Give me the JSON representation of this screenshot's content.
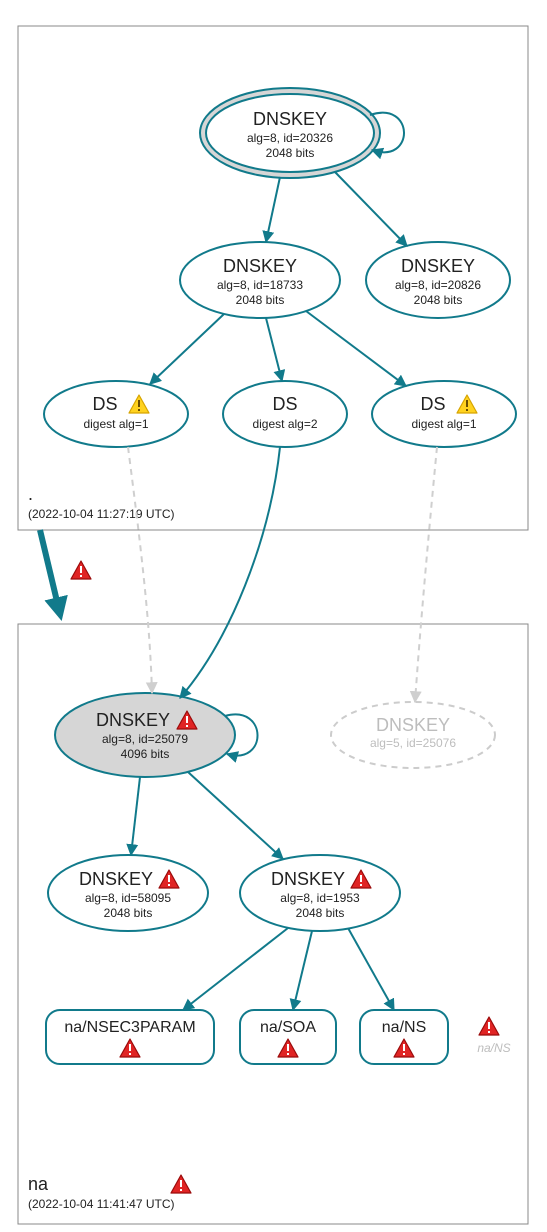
{
  "zone_root": {
    "label": ".",
    "timestamp": "(2022-10-04 11:27:19 UTC)"
  },
  "zone_na": {
    "label": "na",
    "timestamp": "(2022-10-04 11:41:47 UTC)"
  },
  "root_ksk": {
    "title": "DNSKEY",
    "line2": "alg=8, id=20326",
    "line3": "2048 bits"
  },
  "root_zsk": {
    "title": "DNSKEY",
    "line2": "alg=8, id=18733",
    "line3": "2048 bits"
  },
  "root_key3": {
    "title": "DNSKEY",
    "line2": "alg=8, id=20826",
    "line3": "2048 bits"
  },
  "ds1": {
    "title": "DS",
    "line2": "digest alg=1"
  },
  "ds2": {
    "title": "DS",
    "line2": "digest alg=2"
  },
  "ds3": {
    "title": "DS",
    "line2": "digest alg=1"
  },
  "na_ksk": {
    "title": "DNSKEY",
    "line2": "alg=8, id=25079",
    "line3": "4096 bits"
  },
  "na_key_faded": {
    "title": "DNSKEY",
    "line2": "alg=5, id=25076"
  },
  "na_zsk1": {
    "title": "DNSKEY",
    "line2": "alg=8, id=58095",
    "line3": "2048 bits"
  },
  "na_zsk2": {
    "title": "DNSKEY",
    "line2": "alg=8, id=1953",
    "line3": "2048 bits"
  },
  "rr1": {
    "label": "na/NSEC3PARAM"
  },
  "rr2": {
    "label": "na/SOA"
  },
  "rr3": {
    "label": "na/NS"
  },
  "extra_ns": {
    "label": "na/NS"
  },
  "icons": {
    "warn": "warning-icon",
    "err": "error-icon"
  }
}
